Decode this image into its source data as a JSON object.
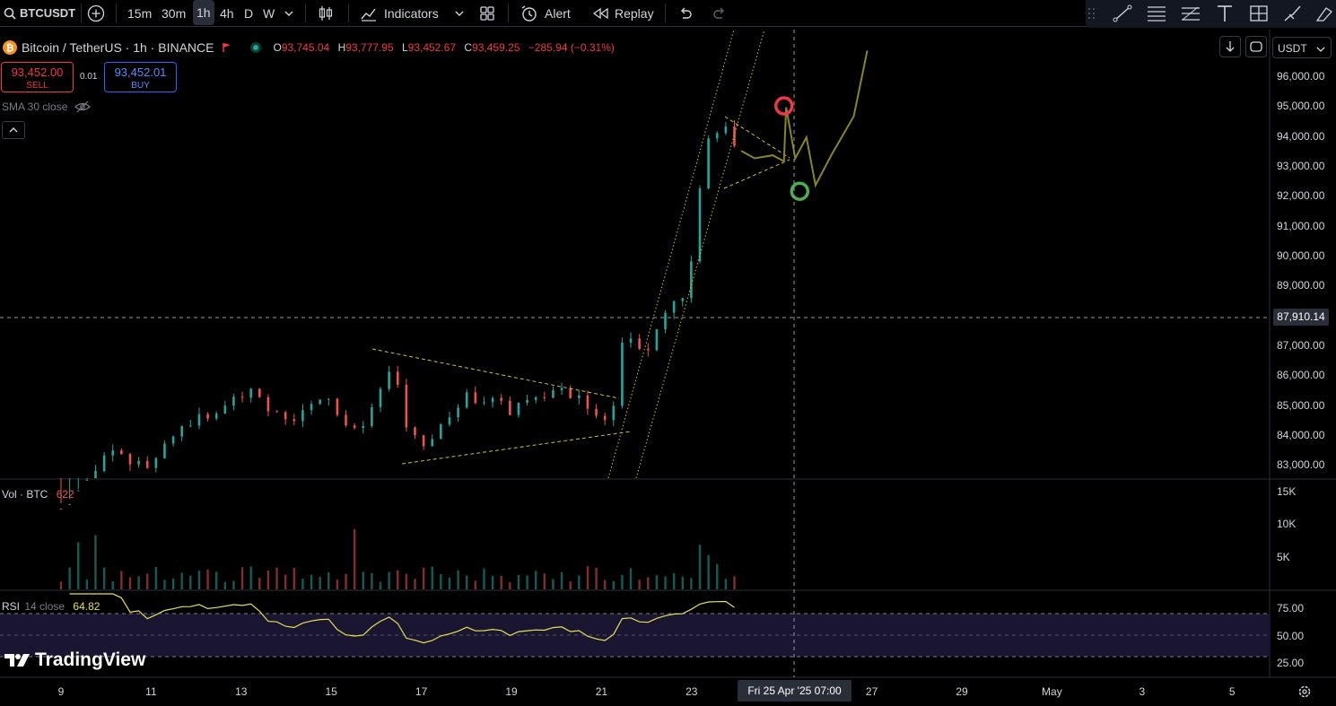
{
  "toolbar": {
    "symbol": "BTCUSDT",
    "timeframes": [
      "15m",
      "30m",
      "1h",
      "4h",
      "D",
      "W"
    ],
    "active_timeframe": "1h",
    "indicators_label": "Indicators",
    "alert_label": "Alert",
    "replay_label": "Replay"
  },
  "legend": {
    "title": "Bitcoin / TetherUS · 1h · BINANCE",
    "open_k": "O",
    "open": "93,745.04",
    "high_k": "H",
    "high": "93,777.95",
    "low_k": "L",
    "low": "93,452.67",
    "close_k": "C",
    "close": "93,459.25",
    "change": "−285.94 (−0.31%)"
  },
  "trade": {
    "sell_price": "93,452.00",
    "sell_label": "SELL",
    "spread": "0.01",
    "buy_price": "93,452.01",
    "buy_label": "BUY"
  },
  "sma_label": "SMA 30 close",
  "currency": "USDT",
  "price_axis": [
    "96,000.00",
    "95,000.00",
    "94,000.00",
    "93,000.00",
    "92,000.00",
    "91,000.00",
    "90,000.00",
    "89,000.00",
    "88,000.00",
    "87,000.00",
    "86,000.00",
    "85,000.00",
    "84,000.00",
    "83,000.00"
  ],
  "crosshair_price": "87,910.14",
  "volume": {
    "title": "Vol · BTC",
    "value": "622",
    "axis": [
      "15K",
      "10K",
      "5K"
    ]
  },
  "rsi": {
    "title": "RSI",
    "params": "14 close",
    "value": "64.82",
    "axis": [
      "75.00",
      "50.00",
      "25.00"
    ]
  },
  "time_axis": [
    "9",
    "11",
    "13",
    "15",
    "17",
    "19",
    "21",
    "23",
    "27",
    "29",
    "May",
    "3",
    "5"
  ],
  "crosshair_date": "Fri 25 Apr '25   07:00",
  "brand": "TradingView",
  "colors": {
    "up": "#26a69a",
    "down": "#ef5350",
    "rsi": "#e5e052",
    "projection": "#8a8528",
    "red_marker": "#f23645",
    "green_marker": "#4caf50"
  },
  "chart_data": {
    "type": "candlestick",
    "symbol": "BTCUSDT",
    "interval": "1h",
    "x_range": [
      "Apr 8 2025",
      "May 6 2025"
    ],
    "y_range": [
      82500,
      96800
    ],
    "path": [
      [
        9,
        81500
      ],
      [
        10,
        83300
      ],
      [
        11,
        82900
      ],
      [
        11.5,
        84100
      ],
      [
        12.5,
        84800
      ],
      [
        13.2,
        85600
      ],
      [
        14,
        84300
      ],
      [
        14.5,
        84900
      ],
      [
        15,
        85100
      ],
      [
        15.5,
        84000
      ],
      [
        16,
        85100
      ],
      [
        16.4,
        86300
      ],
      [
        16.6,
        84500
      ],
      [
        17,
        83400
      ],
      [
        17.5,
        84300
      ],
      [
        18,
        85300
      ],
      [
        19,
        84800
      ],
      [
        19.5,
        85300
      ],
      [
        20,
        85500
      ],
      [
        20.5,
        85200
      ],
      [
        21,
        84300
      ],
      [
        21.3,
        85200
      ],
      [
        21.5,
        87400
      ],
      [
        22,
        86600
      ],
      [
        22.3,
        87700
      ],
      [
        22.7,
        88700
      ],
      [
        22.9,
        88300
      ],
      [
        23.1,
        91100
      ],
      [
        23.3,
        93600
      ],
      [
        23.5,
        93900
      ],
      [
        23.7,
        94300
      ],
      [
        23.9,
        93800
      ],
      [
        24.1,
        93450
      ]
    ],
    "projection": [
      [
        24.1,
        93450
      ],
      [
        24.4,
        93200
      ],
      [
        24.8,
        93300
      ],
      [
        25.05,
        93100
      ],
      [
        25.1,
        94900
      ],
      [
        25.3,
        93200
      ],
      [
        25.55,
        93900
      ],
      [
        25.75,
        92300
      ],
      [
        26.1,
        93300
      ],
      [
        26.6,
        94600
      ],
      [
        26.9,
        96800
      ]
    ],
    "markers": [
      {
        "type": "red-circle",
        "x": 25.05,
        "y": 94950
      },
      {
        "type": "green-circle",
        "x": 25.4,
        "y": 92100
      }
    ]
  }
}
